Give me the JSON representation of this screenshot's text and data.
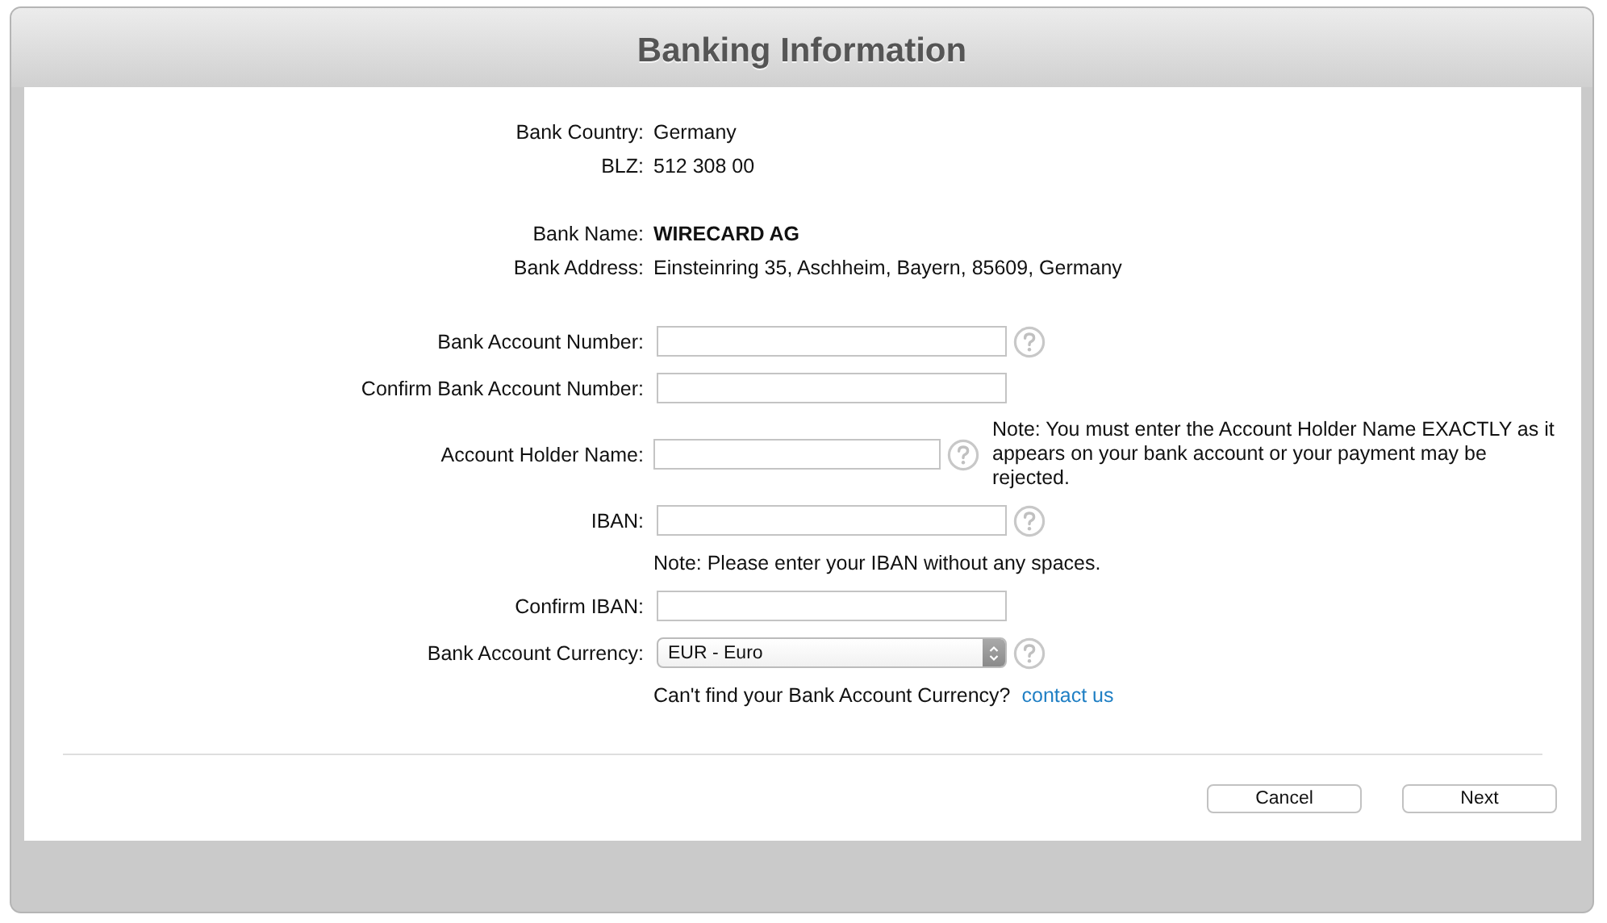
{
  "window": {
    "title": "Banking Information"
  },
  "sections": [
    {
      "rows": [
        {
          "kind": "info",
          "label": "Bank Country:",
          "value": "Germany",
          "bold": false
        },
        {
          "kind": "info",
          "label": "BLZ:",
          "value": "512 308 00",
          "bold": false
        }
      ]
    },
    {
      "rows": [
        {
          "kind": "info",
          "label": "Bank Name:",
          "value": "WIRECARD AG",
          "bold": true
        },
        {
          "kind": "info",
          "label": "Bank Address:",
          "value": "Einsteinring 35, Aschheim, Bayern, 85609, Germany",
          "bold": false
        }
      ]
    },
    {
      "rows": [
        {
          "kind": "field",
          "label": "Bank Account Number:",
          "help": true,
          "short": false
        },
        {
          "kind": "field",
          "label": "Confirm Bank Account Number:",
          "help": false,
          "short": false
        },
        {
          "kind": "field",
          "label": "Account Holder Name:",
          "help": true,
          "short": true,
          "note": "Note: You must enter the Account Holder Name EXACTLY as it appears on your bank account or your payment may be rejected."
        },
        {
          "kind": "field",
          "label": "IBAN:",
          "help": true,
          "short": false
        },
        {
          "kind": "note",
          "text": "Note: Please enter your IBAN without any spaces."
        },
        {
          "kind": "field",
          "label": "Confirm IBAN:",
          "help": false,
          "short": false
        },
        {
          "kind": "select",
          "label": "Bank Account Currency:",
          "value": "EUR - Euro",
          "help": true
        },
        {
          "kind": "link-note",
          "text": "Can't find your Bank Account Currency?",
          "link": "contact us"
        }
      ]
    }
  ],
  "buttons": [
    "Cancel",
    "Next"
  ]
}
